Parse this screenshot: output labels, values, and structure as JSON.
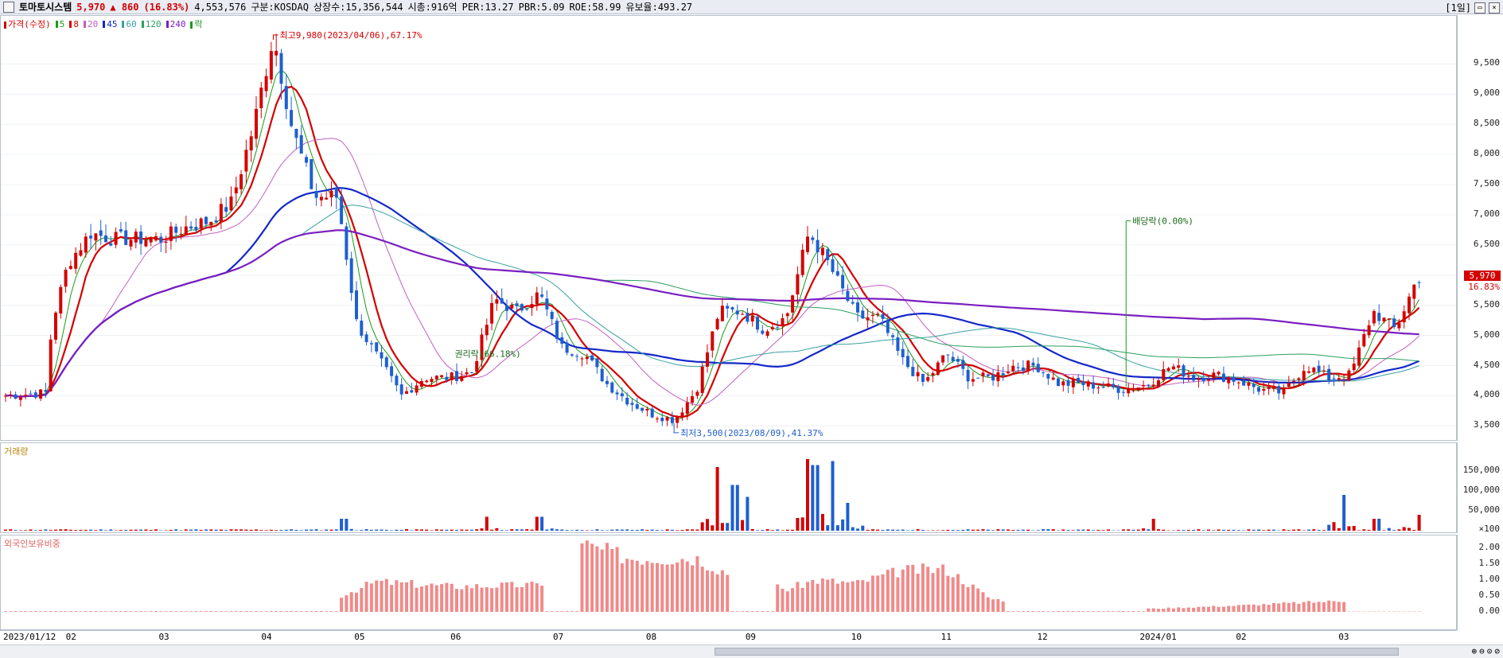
{
  "header": {
    "name": "토마토시스템",
    "price": "5,970",
    "change": "▲ 860",
    "change_pct": "(16.83%)",
    "volume": "4,553,576",
    "market": "구분:KOSDAQ",
    "shares": "상장수:15,356,544",
    "mcap": "시총:916억",
    "per": "PER:13.27",
    "pbr": "PBR:5.09",
    "roe": "ROE:58.99",
    "retention": "유보율:493.27",
    "period": "[1일]",
    "min_icon": "minimize-icon",
    "max_icon": "maximize-icon",
    "close_icon": "close-icon"
  },
  "price_legend": [
    {
      "label": "가격(수정)",
      "color": "#d40000"
    },
    {
      "label": "5",
      "color": "#1a9a1a"
    },
    {
      "label": "8",
      "color": "#d40000"
    },
    {
      "label": "20",
      "color": "#c060c0"
    },
    {
      "label": "45",
      "color": "#1428c8"
    },
    {
      "label": "60",
      "color": "#3aa0a0"
    },
    {
      "label": "120",
      "color": "#2aa060"
    },
    {
      "label": "240",
      "color": "#7a1fc0"
    },
    {
      "label": "락",
      "color": "#1a9a1a"
    }
  ],
  "volume_legend": "거래량",
  "foreign_legend": "외국인보유비중",
  "annotations": {
    "high": "최고9,980(2023/04/06),67.17%",
    "low": "최저3,500(2023/08/09),41.37%",
    "rights": "권리락(66.18%)",
    "dividend": "배당락(0.00%)"
  },
  "last_price": {
    "price": "5,970",
    "pct": "16.83%"
  },
  "x_labels": [
    "2023/01/12",
    "02",
    "03",
    "04",
    "05",
    "06",
    "07",
    "08",
    "09",
    "10",
    "11",
    "12",
    "2024/01",
    "02",
    "03"
  ],
  "price_ticks": [
    "9,500",
    "9,000",
    "8,500",
    "8,000",
    "7,500",
    "7,000",
    "6,500",
    "6,000",
    "5,500",
    "5,000",
    "4,500",
    "4,000",
    "3,500"
  ],
  "volume_ticks": [
    "150,000",
    "100,000",
    "50,000",
    "×100"
  ],
  "foreign_ticks": [
    "2.00",
    "1.50",
    "1.00",
    "0.50",
    "0.00"
  ],
  "colors": {
    "up": "#d40000",
    "down": "#1e5fd0",
    "foreign": "#f08a8a",
    "ma5": "#1a9a1a",
    "ma8": "#d40000",
    "ma20": "#c060c0",
    "ma45": "#1428c8",
    "ma60": "#3aa0a0",
    "ma120": "#2aa060",
    "ma240": "#7a1fc0"
  },
  "zoom_icons": [
    "zoom-in-icon",
    "zoom-out-icon",
    "zoom-fit-icon",
    "zoom-reset-icon"
  ],
  "chart_data": {
    "type": "candlestick",
    "x_range": [
      "2023/01/12",
      "2024/03"
    ],
    "price_ylim": [
      3400,
      9980
    ],
    "price_points": [
      {
        "x": "2023/01/12",
        "y": 4000
      },
      {
        "x": "2023/01/25",
        "y": 4050
      },
      {
        "x": "2023/01/27",
        "y": 5200
      },
      {
        "x": "2023/02/01",
        "y": 6200
      },
      {
        "x": "2023/02/08",
        "y": 6700
      },
      {
        "x": "2023/02/15",
        "y": 6600
      },
      {
        "x": "2023/02/22",
        "y": 6600
      },
      {
        "x": "2023/03/02",
        "y": 6600
      },
      {
        "x": "2023/03/10",
        "y": 6800
      },
      {
        "x": "2023/03/17",
        "y": 6900
      },
      {
        "x": "2023/03/24",
        "y": 7200
      },
      {
        "x": "2023/03/31",
        "y": 8500
      },
      {
        "x": "2023/04/06",
        "y": 9980
      },
      {
        "x": "2023/04/12",
        "y": 8400
      },
      {
        "x": "2023/04/19",
        "y": 7300
      },
      {
        "x": "2023/04/26",
        "y": 7300
      },
      {
        "x": "2023/05/02",
        "y": 5200
      },
      {
        "x": "2023/05/09",
        "y": 4600
      },
      {
        "x": "2023/05/16",
        "y": 4000
      },
      {
        "x": "2023/05/23",
        "y": 4300
      },
      {
        "x": "2023/05/31",
        "y": 4300
      },
      {
        "x": "2023/06/07",
        "y": 4400
      },
      {
        "x": "2023/06/14",
        "y": 5600
      },
      {
        "x": "2023/06/21",
        "y": 5400
      },
      {
        "x": "2023/06/28",
        "y": 5700
      },
      {
        "x": "2023/07/05",
        "y": 4800
      },
      {
        "x": "2023/07/12",
        "y": 4700
      },
      {
        "x": "2023/07/19",
        "y": 4200
      },
      {
        "x": "2023/07/26",
        "y": 3900
      },
      {
        "x": "2023/08/02",
        "y": 3700
      },
      {
        "x": "2023/08/09",
        "y": 3600
      },
      {
        "x": "2023/08/16",
        "y": 4100
      },
      {
        "x": "2023/08/23",
        "y": 5400
      },
      {
        "x": "2023/08/30",
        "y": 5400
      },
      {
        "x": "2023/09/06",
        "y": 5100
      },
      {
        "x": "2023/09/13",
        "y": 5300
      },
      {
        "x": "2023/09/20",
        "y": 6700
      },
      {
        "x": "2023/09/25",
        "y": 6300
      },
      {
        "x": "2023/10/05",
        "y": 5300
      },
      {
        "x": "2023/10/12",
        "y": 5300
      },
      {
        "x": "2023/10/19",
        "y": 4600
      },
      {
        "x": "2023/10/26",
        "y": 4200
      },
      {
        "x": "2023/11/02",
        "y": 4700
      },
      {
        "x": "2023/11/09",
        "y": 4300
      },
      {
        "x": "2023/11/16",
        "y": 4300
      },
      {
        "x": "2023/11/23",
        "y": 4500
      },
      {
        "x": "2023/11/30",
        "y": 4500
      },
      {
        "x": "2023/12/07",
        "y": 4200
      },
      {
        "x": "2023/12/14",
        "y": 4200
      },
      {
        "x": "2023/12/21",
        "y": 4150
      },
      {
        "x": "2023/12/28",
        "y": 4100
      },
      {
        "x": "2024/01/04",
        "y": 4200
      },
      {
        "x": "2024/01/11",
        "y": 4500
      },
      {
        "x": "2024/01/18",
        "y": 4300
      },
      {
        "x": "2024/01/25",
        "y": 4350
      },
      {
        "x": "2024/02/01",
        "y": 4250
      },
      {
        "x": "2024/02/08",
        "y": 4100
      },
      {
        "x": "2024/02/15",
        "y": 4050
      },
      {
        "x": "2024/02/22",
        "y": 4500
      },
      {
        "x": "2024/02/29",
        "y": 4300
      },
      {
        "x": "2024/03/07",
        "y": 4350
      },
      {
        "x": "2024/03/14",
        "y": 5400
      },
      {
        "x": "2024/03/21",
        "y": 5100
      },
      {
        "x": "2024/03/28",
        "y": 5970
      }
    ],
    "volume_ylim": [
      0,
      180000
    ],
    "volume_points": [
      {
        "x": "2023/04/28",
        "y": 30000
      },
      {
        "x": "2023/06/12",
        "y": 35000
      },
      {
        "x": "2023/06/28",
        "y": 35000
      },
      {
        "x": "2023/08/22",
        "y": 160000
      },
      {
        "x": "2023/08/28",
        "y": 115000
      },
      {
        "x": "2023/09/01",
        "y": 85000
      },
      {
        "x": "2023/09/20",
        "y": 180000
      },
      {
        "x": "2023/09/22",
        "y": 165000
      },
      {
        "x": "2023/09/27",
        "y": 175000
      },
      {
        "x": "2023/10/02",
        "y": 70000
      },
      {
        "x": "2024/01/05",
        "y": 30000
      },
      {
        "x": "2024/03/05",
        "y": 90000
      },
      {
        "x": "2024/03/15",
        "y": 30000
      },
      {
        "x": "2024/03/28",
        "y": 40000
      }
    ],
    "foreign_ylim": [
      0,
      2.2
    ],
    "foreign_points": [
      {
        "x": "2023/04/27",
        "y": 0.5
      },
      {
        "x": "2023/05/08",
        "y": 0.95
      },
      {
        "x": "2023/06/01",
        "y": 0.8
      },
      {
        "x": "2023/06/28",
        "y": 0.85
      },
      {
        "x": "2023/07/12",
        "y": 2.1
      },
      {
        "x": "2023/07/26",
        "y": 1.7
      },
      {
        "x": "2023/08/16",
        "y": 1.7
      },
      {
        "x": "2023/08/24",
        "y": 1.3
      },
      {
        "x": "2023/09/13",
        "y": 0.7
      },
      {
        "x": "2023/09/22",
        "y": 1.0
      },
      {
        "x": "2023/10/05",
        "y": 0.9
      },
      {
        "x": "2023/10/19",
        "y": 1.3
      },
      {
        "x": "2023/11/02",
        "y": 1.35
      },
      {
        "x": "2023/11/16",
        "y": 0.4
      },
      {
        "x": "2024/01/05",
        "y": 0.1
      },
      {
        "x": "2024/02/01",
        "y": 0.2
      },
      {
        "x": "2024/03/05",
        "y": 0.35
      }
    ]
  }
}
